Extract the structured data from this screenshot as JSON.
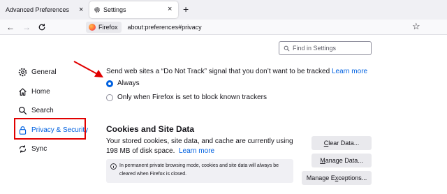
{
  "tabs": [
    {
      "label": "Advanced Preferences",
      "close": "×"
    },
    {
      "label": "Settings",
      "close": "×",
      "icon": "gear-icon"
    }
  ],
  "new_tab": "+",
  "nav": {
    "back": "←",
    "forward": "→",
    "identity_label": "Firefox",
    "url": "about:preferences#privacy",
    "bookmark": "☆"
  },
  "search": {
    "placeholder": "Find in Settings"
  },
  "sidebar": {
    "items": [
      {
        "label": "General",
        "icon": "gear-icon"
      },
      {
        "label": "Home",
        "icon": "home-icon"
      },
      {
        "label": "Search",
        "icon": "search-icon"
      },
      {
        "label": "Privacy & Security",
        "icon": "lock-icon"
      },
      {
        "label": "Sync",
        "icon": "sync-icon"
      }
    ]
  },
  "dnt": {
    "label": "Send web sites a “Do Not Track” signal that you don’t want to be tracked",
    "learn_more": "Learn more",
    "options": [
      "Always",
      "Only when Firefox is set to block known trackers"
    ],
    "selected": "Always"
  },
  "cookies": {
    "title": "Cookies and Site Data",
    "desc": "Your stored cookies, site data, and cache are currently using 198 MB of disk space.",
    "learn_more": "Learn more",
    "info": "In permanent private browsing mode, cookies and site data will always be cleared when Firefox is closed.",
    "buttons": {
      "clear": {
        "pre": "",
        "key": "C",
        "post": "lear Data..."
      },
      "manage": {
        "pre": "",
        "key": "M",
        "post": "anage Data..."
      },
      "exceptions": {
        "pre": "Manage E",
        "key": "x",
        "post": "ceptions..."
      }
    }
  },
  "colors": {
    "accent": "#0061e0",
    "highlight": "#e10000"
  }
}
